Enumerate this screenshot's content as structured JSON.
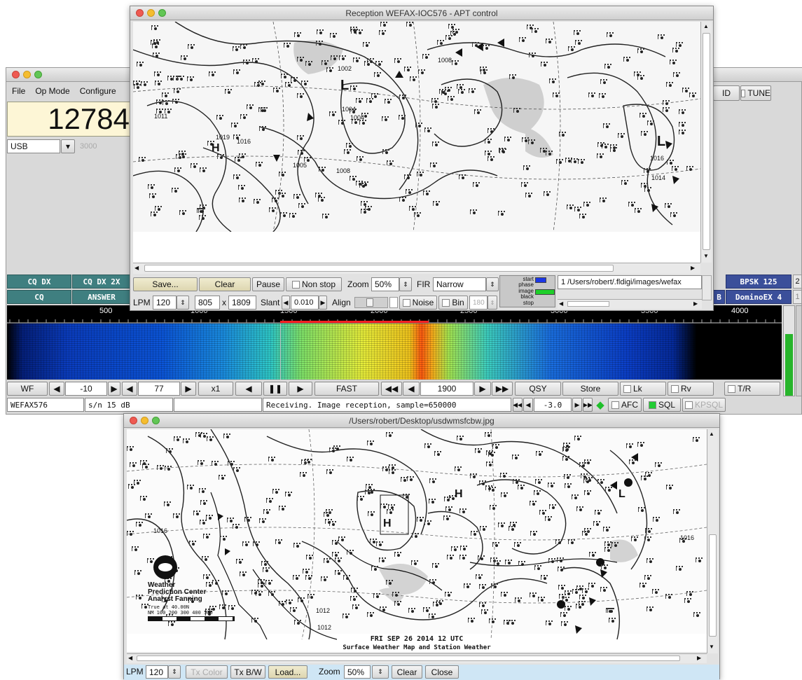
{
  "main_window": {
    "menu": [
      "File",
      "Op Mode",
      "Configure"
    ],
    "frequency": "12784",
    "mode": "USB",
    "bandwidth": "3000",
    "right_buttons": [
      "ID",
      "TUNE"
    ],
    "macros_row1": [
      "CQ DX",
      "CQ DX 2X"
    ],
    "macros_row2": [
      "CQ",
      "ANSWER"
    ],
    "macros_right_row1": [
      "BPSK 125",
      "2"
    ],
    "macros_right_row2": [
      "B",
      "DominoEX 4",
      "1"
    ],
    "scale_ticks": [
      "500",
      "1000",
      "1500",
      "2000",
      "2500",
      "3000",
      "3500",
      "4000"
    ],
    "wf_controls": {
      "wf": "WF",
      "gain": "-10",
      "range": "77",
      "zoom": "x1",
      "speed": "FAST",
      "carrier": "1900",
      "qsy": "QSY",
      "store": "Store",
      "lk": "Lk",
      "rv": "Rv",
      "tr": "T/R"
    },
    "status": {
      "mode": "WEFAX576",
      "sn": "s/n  15 dB",
      "message": "Receiving. Image reception, sample=650000",
      "offset": "-3.0",
      "afc": "AFC",
      "sql": "SQL",
      "kpsql": "KPSQL"
    }
  },
  "rx_window": {
    "title": "Reception WEFAX-IOC576 - APT control",
    "map_labels": [
      "1008",
      "1002",
      "1004",
      "1004",
      "1019",
      "1016",
      "1011",
      "1008",
      "1005",
      "1014",
      "1016",
      "L",
      "H",
      "L"
    ],
    "save": "Save...",
    "clear": "Clear",
    "pause": "Pause",
    "non_stop": "Non stop",
    "zoom_label": "Zoom",
    "zoom_value": "50%",
    "fir_label": "FIR",
    "fir_value": "Narrow",
    "lpm_label": "LPM",
    "lpm_value": "120",
    "width": "805",
    "times": "x",
    "height": "1809",
    "slant_label": "Slant",
    "slant_value": "0.010",
    "align_label": "Align",
    "noise": "Noise",
    "bin": "Bin",
    "bin_value": "180",
    "state_labels": [
      "start",
      "phase",
      "image",
      "black",
      "stop"
    ],
    "file_path": "1 /Users/robert/.fldigi/images/wefax"
  },
  "img_window": {
    "title": "/Users/robert/Desktop/usdwmsfcbw.jpg",
    "map_labels": [
      "1016",
      "1016",
      "1012",
      "1012",
      "H",
      "H",
      "L"
    ],
    "noaa_text": [
      "Weather",
      "Prediction Center",
      "Analyst Fanning"
    ],
    "scale_text": [
      "True at 40.00N",
      "NM  100   200   300   400   500"
    ],
    "caption1": "FRI SEP 26 2014 12 UTC",
    "caption2": "Surface Weather Map and Station Weather",
    "lpm_label": "LPM",
    "lpm_value": "120",
    "tx_color": "Tx Color",
    "tx_bw": "Tx B/W",
    "load": "Load...",
    "zoom_label": "Zoom",
    "zoom_value": "50%",
    "clear": "Clear",
    "close": "Close"
  }
}
